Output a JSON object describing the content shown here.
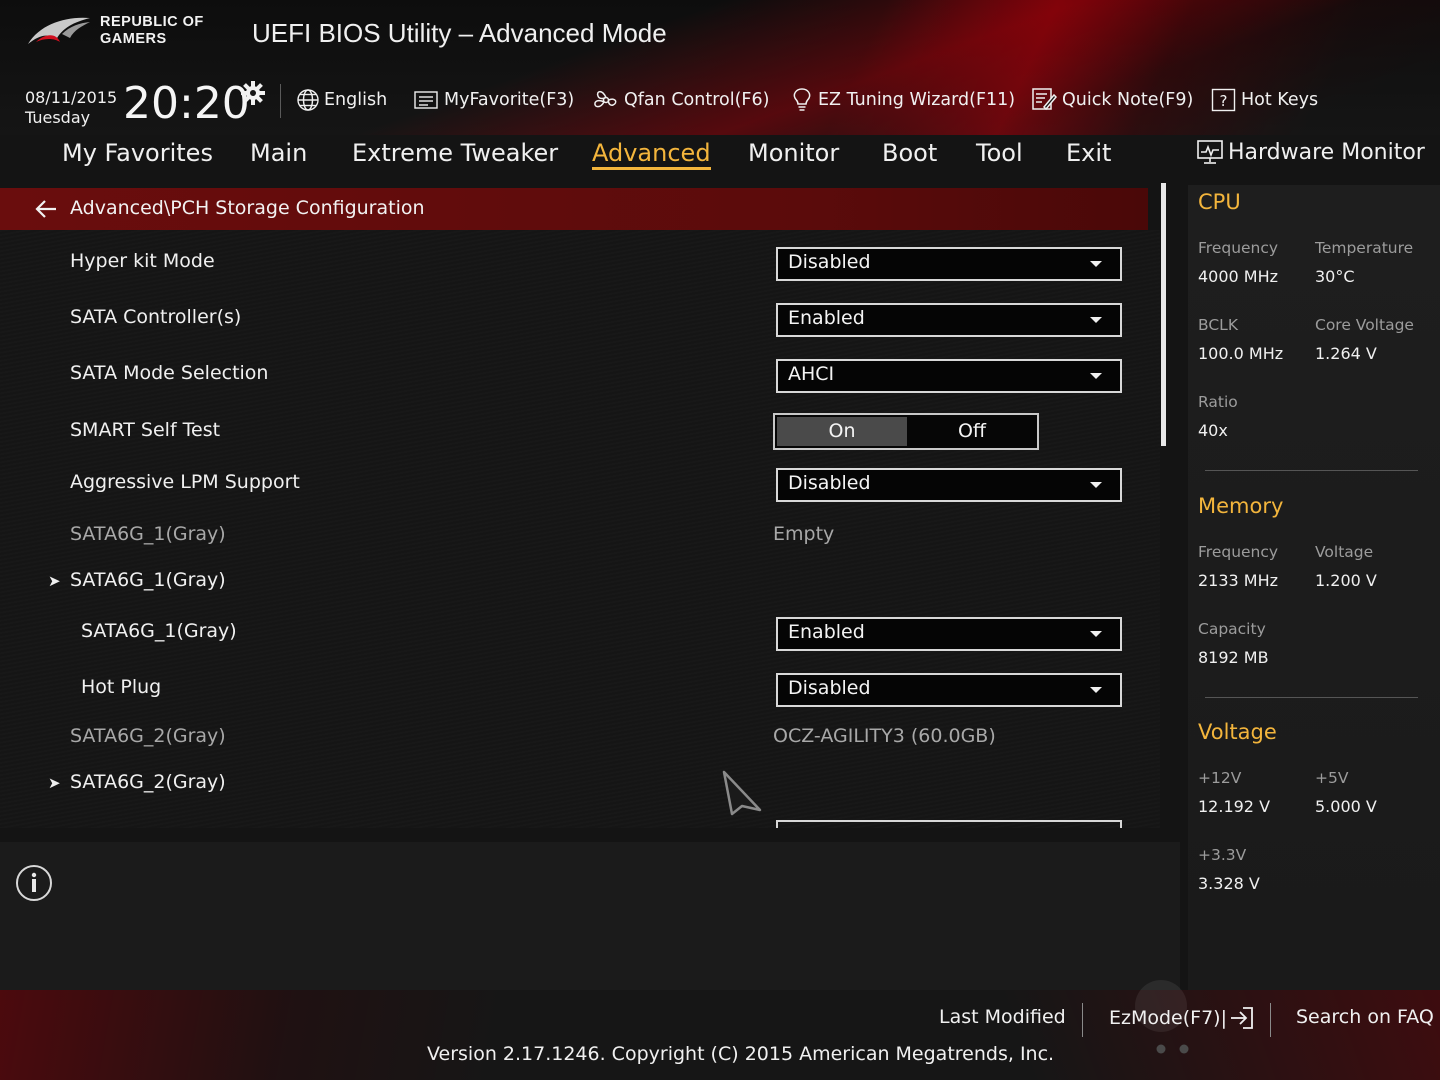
{
  "header": {
    "brand_line1": "REPUBLIC OF",
    "brand_line2": "GAMERS",
    "title": "UEFI BIOS Utility – Advanced Mode",
    "date": "08/11/2015",
    "day": "Tuesday",
    "time": "20:20"
  },
  "toolbar": {
    "language": "English",
    "myfavorite": "MyFavorite(F3)",
    "qfan": "Qfan Control(F6)",
    "ez_tuning": "EZ Tuning Wizard(F11)",
    "quick_note": "Quick Note(F9)",
    "hot_keys": "Hot Keys"
  },
  "nav": {
    "tabs": [
      {
        "label": "My Favorites"
      },
      {
        "label": "Main"
      },
      {
        "label": "Extreme Tweaker"
      },
      {
        "label": "Advanced",
        "active": true
      },
      {
        "label": "Monitor"
      },
      {
        "label": "Boot"
      },
      {
        "label": "Tool"
      },
      {
        "label": "Exit"
      }
    ]
  },
  "breadcrumb": "Advanced\\PCH Storage Configuration",
  "settings": {
    "hyper_kit": {
      "label": "Hyper kit Mode",
      "value": "Disabled"
    },
    "sata_controllers": {
      "label": "SATA Controller(s)",
      "value": "Enabled"
    },
    "sata_mode": {
      "label": "SATA Mode Selection",
      "value": "AHCI"
    },
    "smart_self_test": {
      "label": "SMART Self Test",
      "on": "On",
      "off": "Off",
      "selected": "On"
    },
    "aggressive_lpm": {
      "label": "Aggressive LPM Support",
      "value": "Disabled"
    },
    "sata6g_1_info": {
      "label": "SATA6G_1(Gray)",
      "value": "Empty"
    },
    "sata6g_1_sub": {
      "label": "SATA6G_1(Gray)"
    },
    "sata6g_1_port": {
      "label": "SATA6G_1(Gray)",
      "value": "Enabled"
    },
    "hot_plug": {
      "label": "Hot Plug",
      "value": "Disabled"
    },
    "sata6g_2_info": {
      "label": "SATA6G_2(Gray)",
      "value": "OCZ-AGILITY3 (60.0GB)"
    },
    "sata6g_2_sub": {
      "label": "SATA6G_2(Gray)"
    }
  },
  "hardware_monitor": {
    "title": "Hardware Monitor",
    "cpu": {
      "section": "CPU",
      "frequency_label": "Frequency",
      "frequency": "4000 MHz",
      "temperature_label": "Temperature",
      "temperature": "30°C",
      "bclk_label": "BCLK",
      "bclk": "100.0 MHz",
      "core_voltage_label": "Core Voltage",
      "core_voltage": "1.264 V",
      "ratio_label": "Ratio",
      "ratio": "40x"
    },
    "memory": {
      "section": "Memory",
      "frequency_label": "Frequency",
      "frequency": "2133 MHz",
      "voltage_label": "Voltage",
      "voltage": "1.200 V",
      "capacity_label": "Capacity",
      "capacity": "8192 MB"
    },
    "voltage": {
      "section": "Voltage",
      "v12_label": "+12V",
      "v12": "12.192 V",
      "v5_label": "+5V",
      "v5": "5.000 V",
      "v33_label": "+3.3V",
      "v33": "3.328 V"
    }
  },
  "footer": {
    "last_modified": "Last Modified",
    "ezmode": "EzMode(F7)|",
    "search_faq": "Search on FAQ",
    "version": "Version 2.17.1246. Copyright (C) 2015 American Megatrends, Inc."
  },
  "colors": {
    "accent": "#f3b53c",
    "breadcrumb_bar": "#6a0d0d",
    "background": "#141414"
  }
}
